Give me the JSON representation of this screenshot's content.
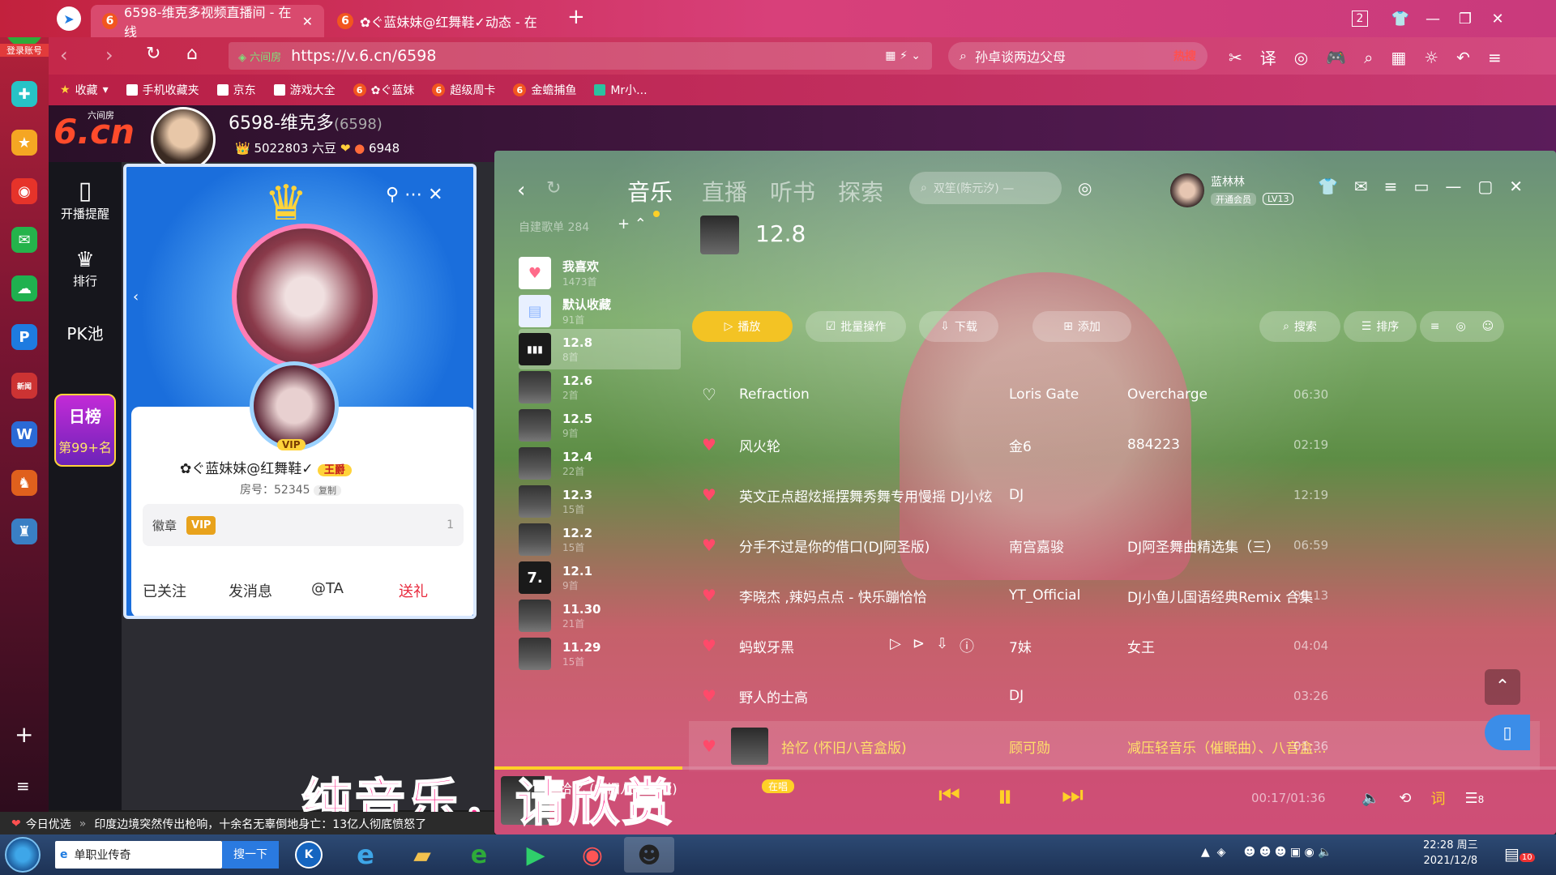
{
  "browser": {
    "tabs": [
      {
        "label": "6598-维克多视频直播间 - 在线",
        "active": true
      },
      {
        "label": "✿ぐ蓝妹妹@红舞鞋✓动态 - 在",
        "active": false
      }
    ],
    "new_tab": "+",
    "window_controls": {
      "count": "2",
      "min": "—",
      "max": "❐",
      "close": "✕"
    },
    "url": "https://v.6.cn/6598",
    "url_secure_label": "六间房",
    "search": {
      "value": "孙卓谈两边父母",
      "badge": "热搜"
    },
    "account_label": "登录账号",
    "bookmarks": [
      "收藏",
      "手机收藏夹",
      "京东",
      "游戏大全",
      "✿ぐ蓝妹",
      "超级周卡",
      "金蟾捕鱼",
      "Mr小..."
    ]
  },
  "room": {
    "logo": "6.cn",
    "logo_sub": "六间房",
    "title": "6598-维克多",
    "room_id": "(6598)",
    "coins": "5022803 六豆",
    "fans": "6948",
    "nav": [
      {
        "label": "开播提醒",
        "icon": "phone-icon"
      },
      {
        "label": "排行",
        "icon": "crown-icon"
      },
      {
        "label": "PK池",
        "icon": "pk-icon"
      }
    ],
    "daily_rank": {
      "title": "日榜",
      "rank": "第99+名"
    }
  },
  "user_popup": {
    "name": "✿ぐ蓝妹妹@红舞鞋✓",
    "badge": "王爵",
    "room_label": "房号：52345",
    "copy": "复制",
    "medal_label": "徽章",
    "medal_value": "VIP",
    "medal_count": "1",
    "buttons": [
      "已关注",
      "发消息",
      "@TA",
      "送礼"
    ],
    "vip_tag": "VIP"
  },
  "music": {
    "tabs": [
      "音乐",
      "直播",
      "听书",
      "探索"
    ],
    "active_tab": 0,
    "search_placeholder": "双笙(陈元汐) —",
    "user": {
      "name": "蓝林林",
      "badge": "开通会员",
      "level": "LV13"
    },
    "playlist_header": "自建歌单 284",
    "playlists": [
      {
        "name": "我喜欢",
        "count": "1473首",
        "type": "heart"
      },
      {
        "name": "默认收藏",
        "count": "91首",
        "type": "box"
      },
      {
        "name": "12.8",
        "count": "8首",
        "type": "wave",
        "active": true
      },
      {
        "name": "12.6",
        "count": "2首"
      },
      {
        "name": "12.5",
        "count": "9首"
      },
      {
        "name": "12.4",
        "count": "22首"
      },
      {
        "name": "12.3",
        "count": "15首"
      },
      {
        "name": "12.2",
        "count": "15首"
      },
      {
        "name": "12.1",
        "count": "9首",
        "type": "seven"
      },
      {
        "name": "11.30",
        "count": "21首"
      },
      {
        "name": "11.29",
        "count": "15首"
      }
    ],
    "current_playlist": "12.8",
    "actions": [
      "播放",
      "批量操作",
      "下载",
      "添加",
      "搜索",
      "排序"
    ],
    "songs": [
      {
        "title": "Refraction",
        "artist": "Loris Gate",
        "album": "Overcharge",
        "duration": "06:30",
        "liked": false
      },
      {
        "title": "风火轮",
        "artist": "金6",
        "album": "884223",
        "duration": "02:19",
        "liked": true
      },
      {
        "title": "英文正点超炫摇摆舞秀舞专用慢摇 DJ小炫",
        "artist": "DJ",
        "album": "",
        "duration": "12:19",
        "liked": true
      },
      {
        "title": "分手不过是你的借口(DJ阿圣版)",
        "artist": "南宫嘉骏",
        "album": "DJ阿圣舞曲精选集（三）",
        "duration": "06:59",
        "liked": true
      },
      {
        "title": "李晓杰 ,辣妈点点 - 快乐蹦恰恰",
        "artist": "YT_Official",
        "album": "DJ小鱼儿国语经典Remix 合集",
        "duration": "06:13",
        "liked": true
      },
      {
        "title": "蚂蚁牙黑",
        "artist": "7妹",
        "album": "女王",
        "duration": "04:04",
        "liked": true
      },
      {
        "title": "野人的士高",
        "artist": "DJ",
        "album": "",
        "duration": "03:26",
        "liked": true
      },
      {
        "title": "拾忆 (怀旧八音盒版)",
        "artist": "顾可勋",
        "album": "减压轻音乐（催眠曲）、八音盒...",
        "duration": "01:36",
        "liked": true,
        "playing": true
      }
    ],
    "now_playing": {
      "title": "拾忆 (怀旧八音盒版)",
      "status": "在唱",
      "time": "00:17/01:36",
      "lyric_btn": "词",
      "queue": "8"
    },
    "caption": "纯音乐，请欣赏"
  },
  "news": {
    "label": "今日优选",
    "headline": "印度边境突然传出枪响，十余名无辜倒地身亡：13亿人彻底愤怒了"
  },
  "taskbar": {
    "search_item": "单职业传奇",
    "search_btn": "搜一下",
    "time": "22:28 周三",
    "date": "2021/12/8",
    "notif": "10"
  }
}
